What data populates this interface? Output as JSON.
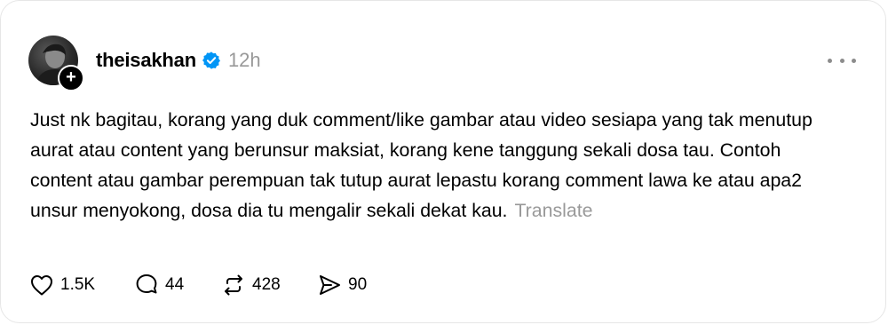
{
  "post": {
    "username": "theisakhan",
    "time": "12h",
    "body": "Just nk bagitau, korang yang duk comment/like gambar atau video sesiapa yang tak menutup aurat atau content yang berunsur maksiat, korang kene tanggung sekali dosa tau. Contoh content atau gambar perempuan tak tutup aurat lepastu korang comment lawa ke atau apa2 unsur menyokong, dosa dia tu mengalir sekali dekat kau.",
    "translate_label": "Translate",
    "follow_symbol": "+"
  },
  "actions": {
    "likes": "1.5K",
    "replies": "44",
    "reposts": "428",
    "shares": "90"
  },
  "icons": {
    "verified": "verified-badge-icon",
    "more": "more-horizontal-icon",
    "like": "heart-icon",
    "reply": "comment-bubble-icon",
    "repost": "repost-icon",
    "share": "send-icon"
  },
  "colors": {
    "verified_blue": "#0095f6",
    "muted_text": "#999999",
    "text": "#000000"
  }
}
